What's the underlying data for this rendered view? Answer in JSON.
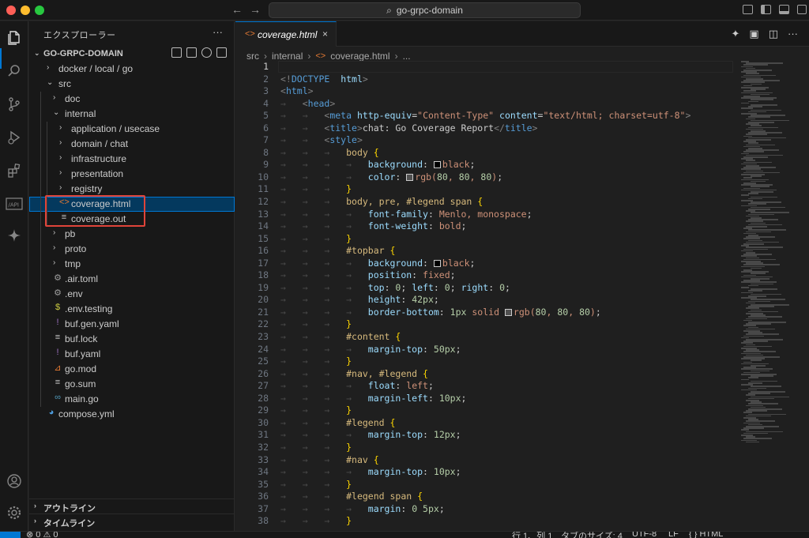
{
  "window": {
    "search_text": "go-grpc-domain",
    "back_label": "←",
    "forward_label": "→"
  },
  "explorer": {
    "title": "エクスプローラー",
    "more": "···",
    "root": "GO-GRPC-DOMAIN",
    "tree": [
      {
        "label": "docker / local / go",
        "depth": 1,
        "kind": "folder",
        "open": false
      },
      {
        "label": "src",
        "depth": 1,
        "kind": "folder",
        "open": true
      },
      {
        "label": "doc",
        "depth": 2,
        "kind": "folder",
        "open": false
      },
      {
        "label": "internal",
        "depth": 2,
        "kind": "folder",
        "open": true
      },
      {
        "label": "application / usecase",
        "depth": 3,
        "kind": "folder",
        "open": false
      },
      {
        "label": "domain / chat",
        "depth": 3,
        "kind": "folder",
        "open": false
      },
      {
        "label": "infrastructure",
        "depth": 3,
        "kind": "folder",
        "open": false
      },
      {
        "label": "presentation",
        "depth": 3,
        "kind": "folder",
        "open": false
      },
      {
        "label": "registry",
        "depth": 3,
        "kind": "folder",
        "open": false
      },
      {
        "label": "coverage.html",
        "depth": 3,
        "kind": "html",
        "selected": true
      },
      {
        "label": "coverage.out",
        "depth": 3,
        "kind": "text"
      },
      {
        "label": "pb",
        "depth": 2,
        "kind": "folder",
        "open": false
      },
      {
        "label": "proto",
        "depth": 2,
        "kind": "folder",
        "open": false
      },
      {
        "label": "tmp",
        "depth": 2,
        "kind": "folder",
        "open": false
      },
      {
        "label": ".air.toml",
        "depth": 2,
        "kind": "gear"
      },
      {
        "label": ".env",
        "depth": 2,
        "kind": "gear"
      },
      {
        "label": ".env.testing",
        "depth": 2,
        "kind": "dollar"
      },
      {
        "label": "buf.gen.yaml",
        "depth": 2,
        "kind": "yaml"
      },
      {
        "label": "buf.lock",
        "depth": 2,
        "kind": "text"
      },
      {
        "label": "buf.yaml",
        "depth": 2,
        "kind": "yaml"
      },
      {
        "label": "go.mod",
        "depth": 2,
        "kind": "rss"
      },
      {
        "label": "go.sum",
        "depth": 2,
        "kind": "text"
      },
      {
        "label": "main.go",
        "depth": 2,
        "kind": "go"
      },
      {
        "label": "compose.yml",
        "depth": 1,
        "kind": "docker"
      }
    ],
    "outline": "アウトライン",
    "timeline": "タイムライン"
  },
  "editor": {
    "tab_label": "coverage.html",
    "tab_close": "×",
    "breadcrumb": [
      "src",
      "internal",
      "coverage.html",
      "..."
    ]
  },
  "code_lines": [
    [],
    [
      [
        "t-punct",
        "<!"
      ],
      [
        "t-tag",
        "DOCTYPE"
      ],
      [
        "",
        "  "
      ],
      [
        "t-attr",
        "html"
      ],
      [
        "t-punct",
        ">"
      ]
    ],
    [
      [
        "t-punct",
        "<"
      ],
      [
        "t-tag",
        "html"
      ],
      [
        "t-punct",
        ">"
      ]
    ],
    [
      [
        "dot",
        "→   "
      ],
      [
        "t-punct",
        "<"
      ],
      [
        "t-tag",
        "head"
      ],
      [
        "t-punct",
        ">"
      ]
    ],
    [
      [
        "dot",
        "→   →   "
      ],
      [
        "t-punct",
        "<"
      ],
      [
        "t-tag",
        "meta"
      ],
      [
        "",
        " "
      ],
      [
        "t-attr",
        "http-equiv"
      ],
      [
        "",
        "="
      ],
      [
        "t-str",
        "\"Content-Type\""
      ],
      [
        "",
        " "
      ],
      [
        "t-attr",
        "content"
      ],
      [
        "",
        "="
      ],
      [
        "t-str",
        "\"text/html; charset=utf-8\""
      ],
      [
        "t-punct",
        ">"
      ]
    ],
    [
      [
        "dot",
        "→   →   "
      ],
      [
        "t-punct",
        "<"
      ],
      [
        "t-tag",
        "title"
      ],
      [
        "t-punct",
        ">"
      ],
      [
        "",
        "chat: Go Coverage Report"
      ],
      [
        "t-punct",
        "</"
      ],
      [
        "t-tag",
        "title"
      ],
      [
        "t-punct",
        ">"
      ]
    ],
    [
      [
        "dot",
        "→   →   "
      ],
      [
        "t-punct",
        "<"
      ],
      [
        "t-tag",
        "style"
      ],
      [
        "t-punct",
        ">"
      ]
    ],
    [
      [
        "dot",
        "→   →   →   "
      ],
      [
        "t-sel",
        "body "
      ],
      [
        "t-brace",
        "{"
      ]
    ],
    [
      [
        "dot",
        "→   →   →   →   "
      ],
      [
        "t-prop",
        "background"
      ],
      [
        "",
        ": "
      ],
      [
        "swatch",
        "#000000"
      ],
      [
        "t-val",
        "black"
      ],
      [
        "",
        ";"
      ]
    ],
    [
      [
        "dot",
        "→   →   →   →   "
      ],
      [
        "t-prop",
        "color"
      ],
      [
        "",
        ": "
      ],
      [
        "swatch",
        "#505050"
      ],
      [
        "t-val",
        "rgb("
      ],
      [
        "t-num",
        "80"
      ],
      [
        "t-val",
        ", "
      ],
      [
        "t-num",
        "80"
      ],
      [
        "t-val",
        ", "
      ],
      [
        "t-num",
        "80"
      ],
      [
        "t-val",
        ")"
      ],
      [
        "",
        ";"
      ]
    ],
    [
      [
        "dot",
        "→   →   →   "
      ],
      [
        "t-brace",
        "}"
      ]
    ],
    [
      [
        "dot",
        "→   →   →   "
      ],
      [
        "t-sel",
        "body, pre, #legend span "
      ],
      [
        "t-brace",
        "{"
      ]
    ],
    [
      [
        "dot",
        "→   →   →   →   "
      ],
      [
        "t-prop",
        "font-family"
      ],
      [
        "",
        ": "
      ],
      [
        "t-val",
        "Menlo, monospace"
      ],
      [
        "",
        ";"
      ]
    ],
    [
      [
        "dot",
        "→   →   →   →   "
      ],
      [
        "t-prop",
        "font-weight"
      ],
      [
        "",
        ": "
      ],
      [
        "t-val",
        "bold"
      ],
      [
        "",
        ";"
      ]
    ],
    [
      [
        "dot",
        "→   →   →   "
      ],
      [
        "t-brace",
        "}"
      ]
    ],
    [
      [
        "dot",
        "→   →   →   "
      ],
      [
        "t-sel",
        "#topbar "
      ],
      [
        "t-brace",
        "{"
      ]
    ],
    [
      [
        "dot",
        "→   →   →   →   "
      ],
      [
        "t-prop",
        "background"
      ],
      [
        "",
        ": "
      ],
      [
        "swatch",
        "#000000"
      ],
      [
        "t-val",
        "black"
      ],
      [
        "",
        ";"
      ]
    ],
    [
      [
        "dot",
        "→   →   →   →   "
      ],
      [
        "t-prop",
        "position"
      ],
      [
        "",
        ": "
      ],
      [
        "t-val",
        "fixed"
      ],
      [
        "",
        ";"
      ]
    ],
    [
      [
        "dot",
        "→   →   →   →   "
      ],
      [
        "t-prop",
        "top"
      ],
      [
        "",
        ": "
      ],
      [
        "t-num",
        "0"
      ],
      [
        "",
        "; "
      ],
      [
        "t-prop",
        "left"
      ],
      [
        "",
        ": "
      ],
      [
        "t-num",
        "0"
      ],
      [
        "",
        "; "
      ],
      [
        "t-prop",
        "right"
      ],
      [
        "",
        ": "
      ],
      [
        "t-num",
        "0"
      ],
      [
        "",
        ";"
      ]
    ],
    [
      [
        "dot",
        "→   →   →   →   "
      ],
      [
        "t-prop",
        "height"
      ],
      [
        "",
        ": "
      ],
      [
        "t-num",
        "42px"
      ],
      [
        "",
        ";"
      ]
    ],
    [
      [
        "dot",
        "→   →   →   →   "
      ],
      [
        "t-prop",
        "border-bottom"
      ],
      [
        "",
        ": "
      ],
      [
        "t-num",
        "1px"
      ],
      [
        "",
        " "
      ],
      [
        "t-val",
        "solid "
      ],
      [
        "swatch",
        "#505050"
      ],
      [
        "t-val",
        "rgb("
      ],
      [
        "t-num",
        "80"
      ],
      [
        "t-val",
        ", "
      ],
      [
        "t-num",
        "80"
      ],
      [
        "t-val",
        ", "
      ],
      [
        "t-num",
        "80"
      ],
      [
        "t-val",
        ")"
      ],
      [
        "",
        ";"
      ]
    ],
    [
      [
        "dot",
        "→   →   →   "
      ],
      [
        "t-brace",
        "}"
      ]
    ],
    [
      [
        "dot",
        "→   →   →   "
      ],
      [
        "t-sel",
        "#content "
      ],
      [
        "t-brace",
        "{"
      ]
    ],
    [
      [
        "dot",
        "→   →   →   →   "
      ],
      [
        "t-prop",
        "margin-top"
      ],
      [
        "",
        ": "
      ],
      [
        "t-num",
        "50px"
      ],
      [
        "",
        ";"
      ]
    ],
    [
      [
        "dot",
        "→   →   →   "
      ],
      [
        "t-brace",
        "}"
      ]
    ],
    [
      [
        "dot",
        "→   →   →   "
      ],
      [
        "t-sel",
        "#nav, #legend "
      ],
      [
        "t-brace",
        "{"
      ]
    ],
    [
      [
        "dot",
        "→   →   →   →   "
      ],
      [
        "t-prop",
        "float"
      ],
      [
        "",
        ": "
      ],
      [
        "t-val",
        "left"
      ],
      [
        "",
        ";"
      ]
    ],
    [
      [
        "dot",
        "→   →   →   →   "
      ],
      [
        "t-prop",
        "margin-left"
      ],
      [
        "",
        ": "
      ],
      [
        "t-num",
        "10px"
      ],
      [
        "",
        ";"
      ]
    ],
    [
      [
        "dot",
        "→   →   →   "
      ],
      [
        "t-brace",
        "}"
      ]
    ],
    [
      [
        "dot",
        "→   →   →   "
      ],
      [
        "t-sel",
        "#legend "
      ],
      [
        "t-brace",
        "{"
      ]
    ],
    [
      [
        "dot",
        "→   →   →   →   "
      ],
      [
        "t-prop",
        "margin-top"
      ],
      [
        "",
        ": "
      ],
      [
        "t-num",
        "12px"
      ],
      [
        "",
        ";"
      ]
    ],
    [
      [
        "dot",
        "→   →   →   "
      ],
      [
        "t-brace",
        "}"
      ]
    ],
    [
      [
        "dot",
        "→   →   →   "
      ],
      [
        "t-sel",
        "#nav "
      ],
      [
        "t-brace",
        "{"
      ]
    ],
    [
      [
        "dot",
        "→   →   →   →   "
      ],
      [
        "t-prop",
        "margin-top"
      ],
      [
        "",
        ": "
      ],
      [
        "t-num",
        "10px"
      ],
      [
        "",
        ";"
      ]
    ],
    [
      [
        "dot",
        "→   →   →   "
      ],
      [
        "t-brace",
        "}"
      ]
    ],
    [
      [
        "dot",
        "→   →   →   "
      ],
      [
        "t-sel",
        "#legend span "
      ],
      [
        "t-brace",
        "{"
      ]
    ],
    [
      [
        "dot",
        "→   →   →   →   "
      ],
      [
        "t-prop",
        "margin"
      ],
      [
        "",
        ": "
      ],
      [
        "t-num",
        "0 5px"
      ],
      [
        "",
        ";"
      ]
    ],
    [
      [
        "dot",
        "→   →   →   "
      ],
      [
        "t-brace",
        "}"
      ]
    ]
  ],
  "statusbar": {
    "errors": "⊗ 0  ⚠ 0",
    "position": "行 1、列 1",
    "tab_size": "タブのサイズ: 4",
    "encoding": "UTF-8",
    "eol": "LF",
    "language": "{ } HTML"
  }
}
